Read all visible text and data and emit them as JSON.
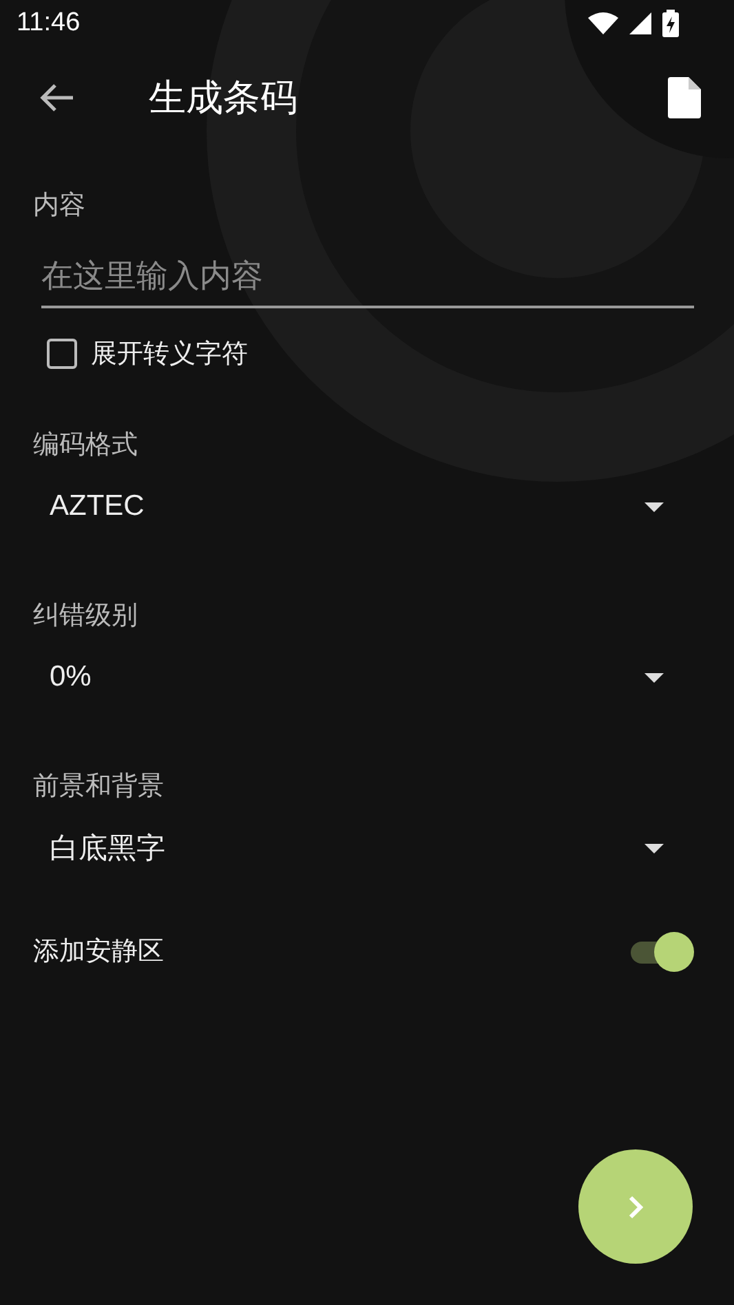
{
  "status_bar": {
    "time": "11:46"
  },
  "toolbar": {
    "title": "生成条码"
  },
  "content_field": {
    "label": "内容",
    "placeholder": "在这里输入内容"
  },
  "escape_checkbox": {
    "label": "展开转义字符",
    "checked": false
  },
  "dropdowns": [
    {
      "label": "编码格式",
      "value": "AZTEC"
    },
    {
      "label": "纠错级别",
      "value": "0%"
    },
    {
      "label": "前景和背景",
      "value": "白底黑字"
    }
  ],
  "quiet_zone": {
    "label": "添加安静区",
    "on": true
  }
}
